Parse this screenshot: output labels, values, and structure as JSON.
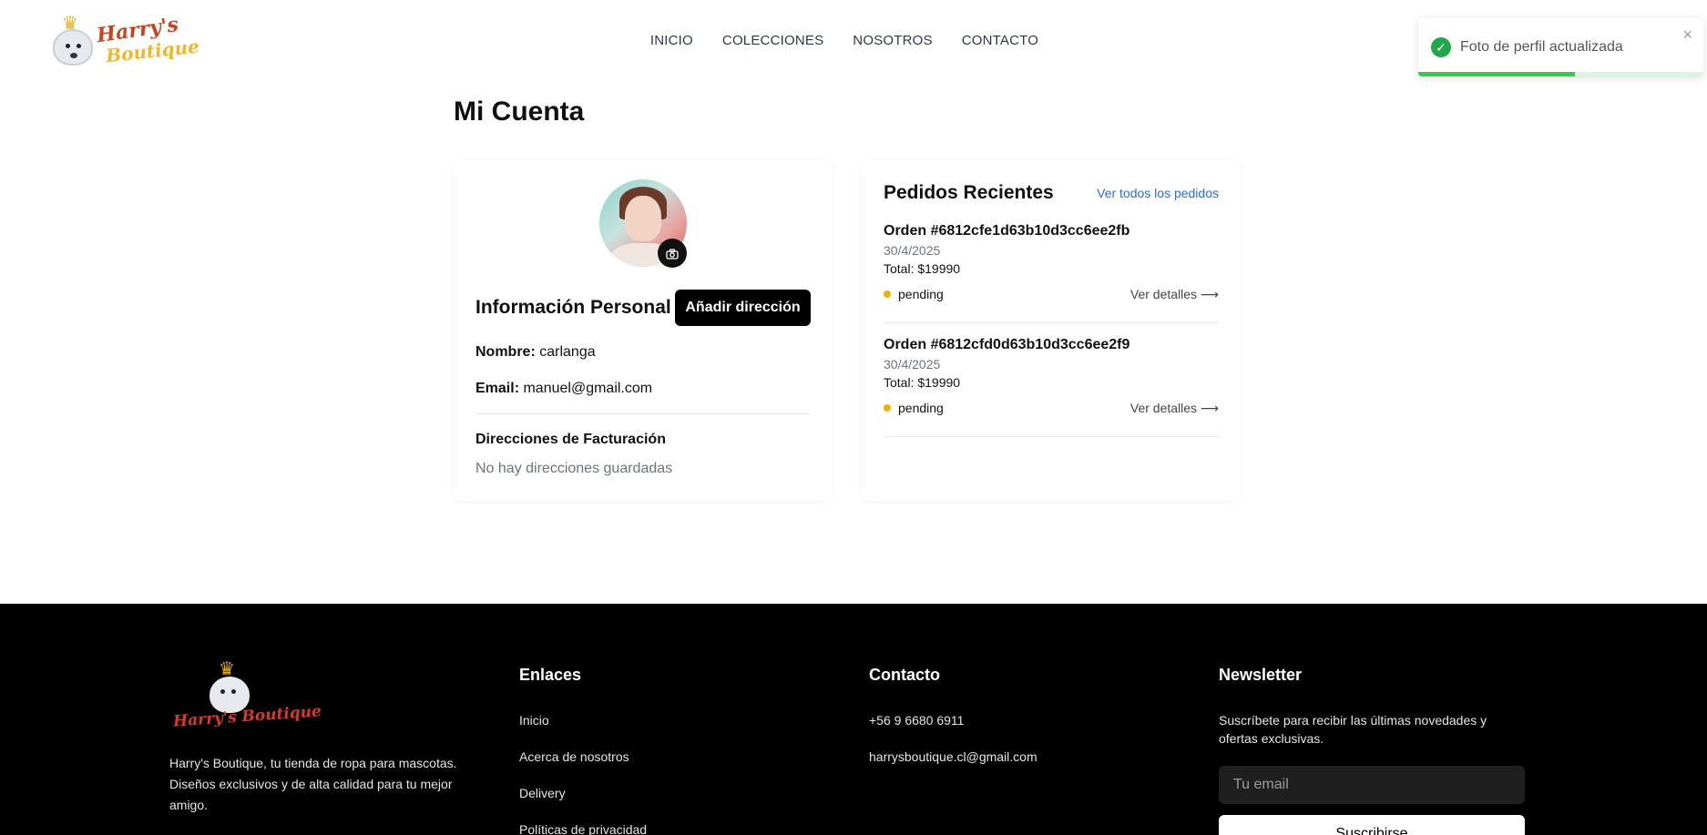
{
  "header": {
    "brand_line1": "Harry's",
    "brand_line2": "Boutique",
    "nav": [
      "INICIO",
      "COLECCIONES",
      "NOSOTROS",
      "CONTACTO"
    ]
  },
  "toast": {
    "message": "Foto de perfil actualizada",
    "close": "×",
    "progress": 0.55,
    "colors": {
      "success": "#22a84a",
      "bar": "#2ecc52"
    }
  },
  "page": {
    "title": "Mi Cuenta"
  },
  "profile": {
    "info_title": "Información Personal",
    "add_address_label": "Añadir dirección",
    "name_label": "Nombre:",
    "name_value": "carlanga",
    "email_label": "Email:",
    "email_value": "manuel@gmail.com",
    "billing_title": "Direcciones de Facturación",
    "billing_empty": "No hay direcciones guardadas",
    "camera_icon": "camera-icon"
  },
  "orders": {
    "title": "Pedidos Recientes",
    "view_all": "Ver todos los pedidos",
    "items": [
      {
        "id": "Orden #6812cfe1d63b10d3cc6ee2fb",
        "date": "30/4/2025",
        "total": "Total: $19990",
        "status": "pending",
        "details": "Ver detalles ⟶"
      },
      {
        "id": "Orden #6812cfd0d63b10d3cc6ee2f9",
        "date": "30/4/2025",
        "total": "Total: $19990",
        "status": "pending",
        "details": "Ver detalles ⟶"
      }
    ],
    "status_color": "#e9b308"
  },
  "footer": {
    "brand": "Harry's Boutique",
    "description": "Harry's Boutique, tu tienda de ropa para mascotas. Diseños exclusivos y de alta calidad para tu mejor amigo.",
    "links_title": "Enlaces",
    "links": [
      "Inicio",
      "Acerca de nosotros",
      "Delivery",
      "Políticas de privacidad"
    ],
    "contact_title": "Contacto",
    "phone": "+56 9 6680 6911",
    "email": "harrysboutique.cl@gmail.com",
    "newsletter_title": "Newsletter",
    "newsletter_text": "Suscríbete para recibir las últimas novedades y ofertas exclusivas.",
    "email_placeholder": "Tu email",
    "subscribe_label": "Suscribirse"
  }
}
